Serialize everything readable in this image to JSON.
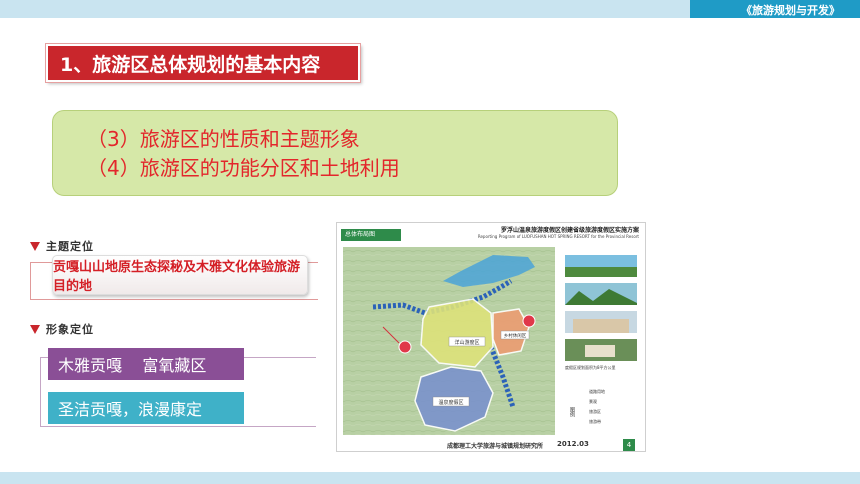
{
  "header": {
    "course_title": "《旅游规划与开发》"
  },
  "section": {
    "heading": "1、旅游区总体规划的基本内容"
  },
  "content_box": {
    "lines": [
      "（3）旅游区的性质和主题形象",
      "（4）旅游区的功能分区和土地利用"
    ]
  },
  "theme_positioning": {
    "label": "主题定位",
    "text": "贡嘎山山地原生态探秘及木雅文化体验旅游目的地"
  },
  "image_positioning": {
    "label": "形象定位",
    "line1": "木雅贡嘎    富氧藏区",
    "line2": "圣洁贡嘎，浪漫康定"
  },
  "map_panel": {
    "tab": "总体布局图",
    "title": "罗浮山温泉旅游度假区创建省级旅游度假区实施方案",
    "subtitle": "Reporting Program of LUOFUSHAN HOT SPRING RESORT for the Provincial Resort",
    "zones": [
      "洋山游度区",
      "温泉度假区",
      "乡村休闲区"
    ],
    "photo_caption": "度假区规划面积为8平方公里",
    "legend_title": "图例",
    "legend_items": [
      "道路用地",
      "景观",
      "旅游区",
      "旅游带"
    ],
    "institute": "成都理工大学旅游与城镇规划研究所",
    "date": "2012.03",
    "page": "4"
  },
  "colors": {
    "heading_bg": "#c9262c",
    "content_bg": "#d6e8a8",
    "content_text": "#e3262b",
    "purple_box": "#8a4f96",
    "teal_box": "#3fb1c8",
    "top_bar": "#1f9bc6"
  },
  "icons": {
    "label_marker": "triangle-down-icon"
  }
}
